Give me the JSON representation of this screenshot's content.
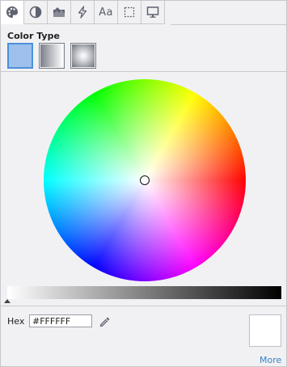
{
  "toolbar": {
    "tabs": [
      {
        "icon": "palette-icon",
        "active": true
      },
      {
        "icon": "contrast-icon",
        "active": false
      },
      {
        "icon": "image-icon",
        "active": false
      },
      {
        "icon": "lightning-icon",
        "active": false
      },
      {
        "icon": "text-icon",
        "label": "Aa",
        "active": false
      },
      {
        "icon": "border-icon",
        "active": false
      },
      {
        "icon": "monitor-icon",
        "active": false
      }
    ]
  },
  "color_type": {
    "title": "Color Type",
    "options": [
      {
        "icon": "solid-swatch-icon",
        "active": true
      },
      {
        "icon": "linear-gradient-icon",
        "active": false
      },
      {
        "icon": "radial-gradient-icon",
        "active": false
      }
    ]
  },
  "picker": {
    "selected_hex": "#FFFFFF",
    "brightness_percent": 0
  },
  "hex": {
    "label": "Hex",
    "value": "#FFFFFF"
  },
  "preview_color": "#FFFFFF",
  "more_link": "More",
  "colors": {
    "accent": "#4A90D9",
    "link": "#3B82C4",
    "panel_bg": "#F1F1F3"
  }
}
